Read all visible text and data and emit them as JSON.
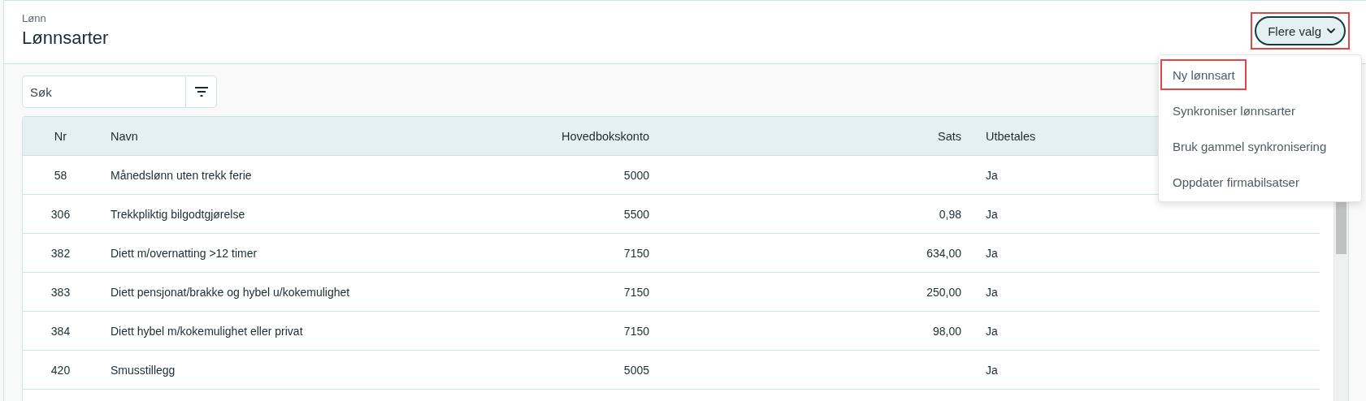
{
  "header": {
    "breadcrumb": "Lønn",
    "title": "Lønnsarter"
  },
  "more_button": {
    "label": "Flere valg",
    "expanded": true,
    "highlighted": true
  },
  "menu": [
    {
      "label": "Ny lønnsart",
      "highlighted": true
    },
    {
      "label": "Synkroniser lønnsarter",
      "highlighted": false
    },
    {
      "label": "Bruk gammel synkronisering",
      "highlighted": false
    },
    {
      "label": "Oppdater firmabilsatser",
      "highlighted": false
    }
  ],
  "search": {
    "placeholder": "Søk"
  },
  "table": {
    "columns": [
      "Nr",
      "Navn",
      "Hovedbokskonto",
      "Sats",
      "Utbetales"
    ],
    "rows": [
      [
        "58",
        "Månedslønn uten trekk ferie",
        "5000",
        "",
        "Ja"
      ],
      [
        "306",
        "Trekkpliktig bilgodtgjørelse",
        "5500",
        "0,98",
        "Ja"
      ],
      [
        "382",
        "Diett m/overnatting >12 timer",
        "7150",
        "634,00",
        "Ja"
      ],
      [
        "383",
        "Diett pensjonat/brakke og hybel u/kokemulighet",
        "7150",
        "250,00",
        "Ja"
      ],
      [
        "384",
        "Diett hybel m/kokemulighet eller privat",
        "7150",
        "98,00",
        "Ja"
      ],
      [
        "420",
        "Smusstillegg",
        "5005",
        "",
        "Ja"
      ]
    ]
  }
}
